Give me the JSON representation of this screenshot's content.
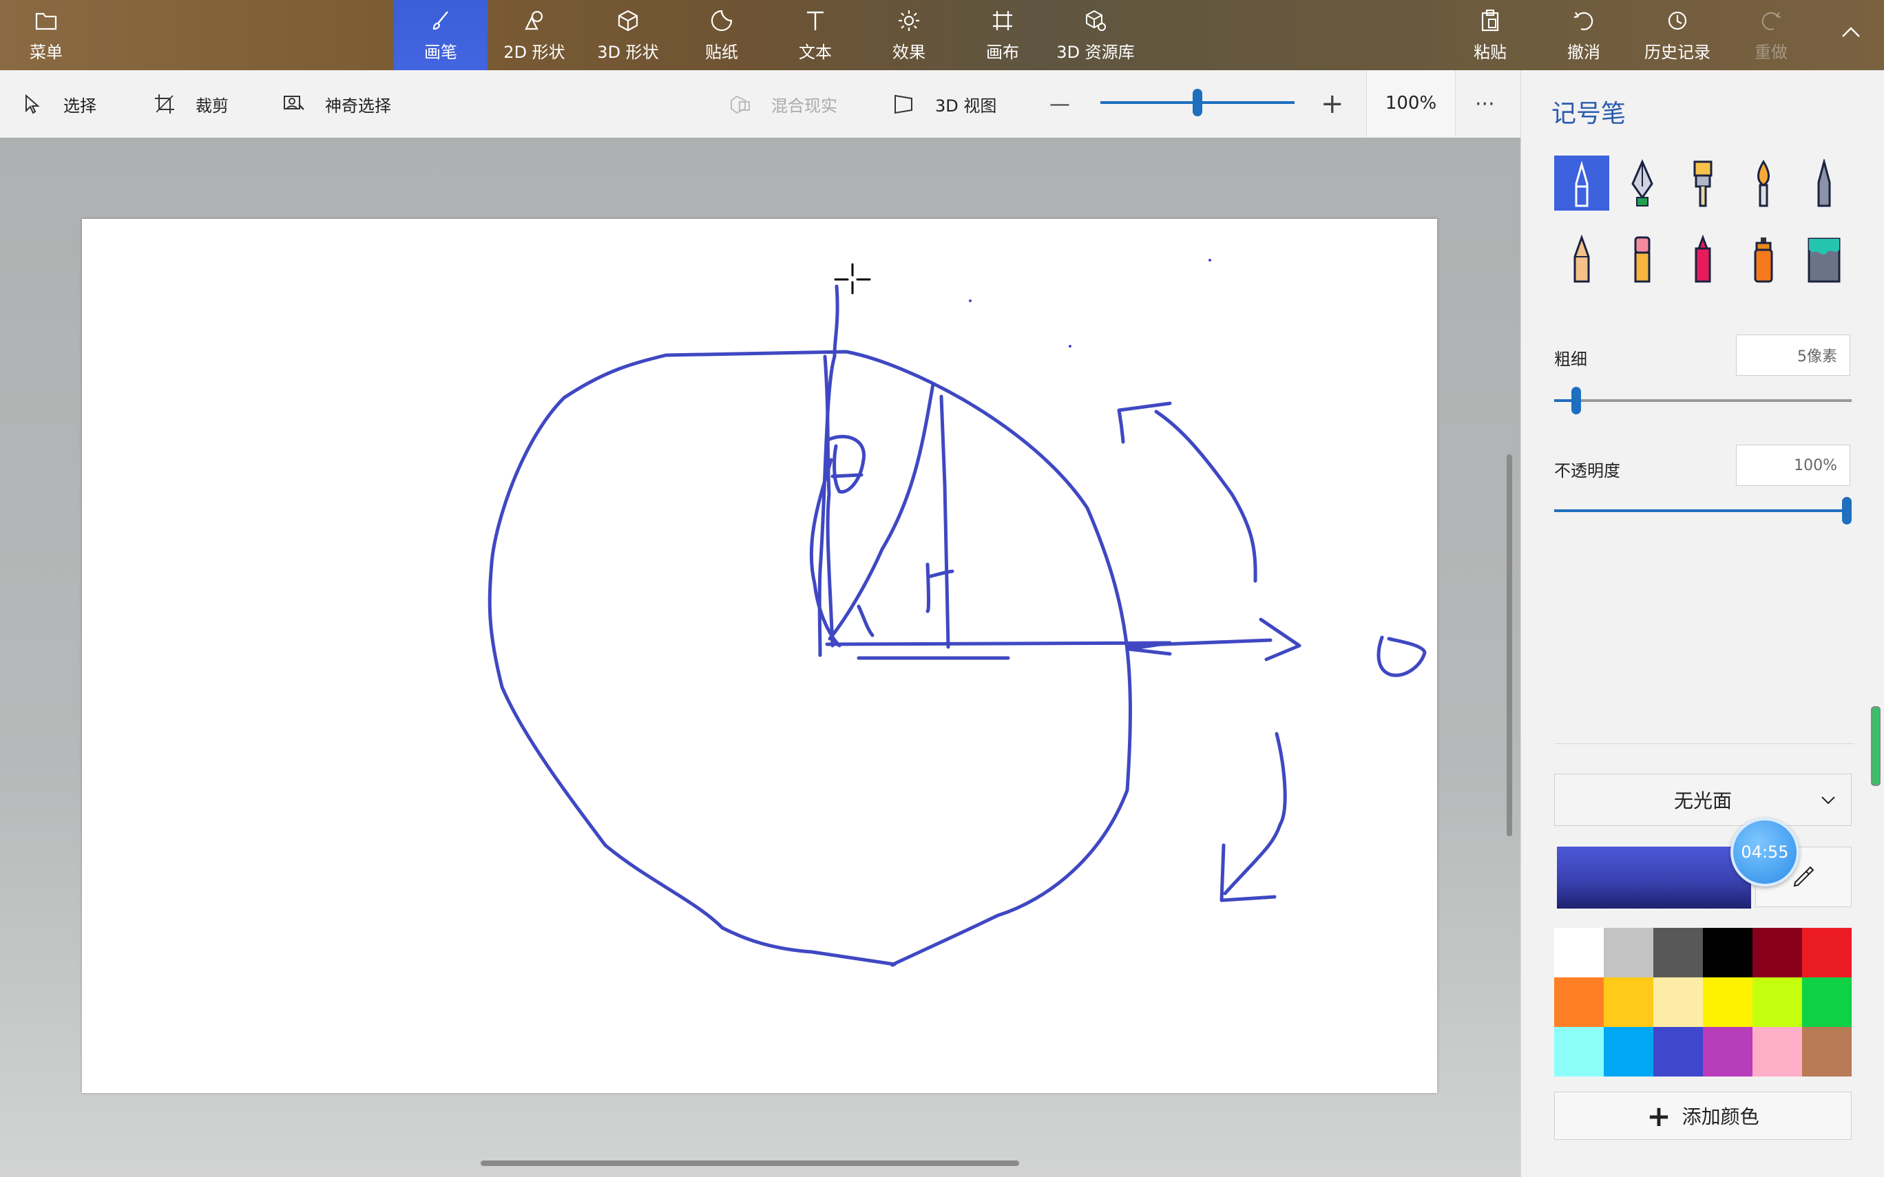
{
  "ribbon": {
    "menu_label": "菜单",
    "tabs": [
      {
        "label": "画笔",
        "icon": "brush-icon",
        "active": true
      },
      {
        "label": "2D 形状",
        "icon": "shapes-2d-icon"
      },
      {
        "label": "3D 形状",
        "icon": "cube-icon"
      },
      {
        "label": "贴纸",
        "icon": "sticker-icon"
      },
      {
        "label": "文本",
        "icon": "text-icon"
      },
      {
        "label": "效果",
        "icon": "sun-icon"
      },
      {
        "label": "画布",
        "icon": "canvas-icon"
      },
      {
        "label": "3D 资源库",
        "icon": "library-3d-icon"
      }
    ],
    "right_actions": [
      {
        "label": "粘贴",
        "icon": "paste-icon"
      },
      {
        "label": "撤消",
        "icon": "undo-icon"
      },
      {
        "label": "历史记录",
        "icon": "history-icon"
      },
      {
        "label": "重做",
        "icon": "redo-icon",
        "disabled": true
      }
    ],
    "collapse_icon": "chevron-up-icon"
  },
  "toolbar": {
    "select_label": "选择",
    "crop_label": "裁剪",
    "magic_select_label": "神奇选择",
    "mixed_reality_label": "混合现实",
    "view3d_label": "3D 视图",
    "zoom_minus": "—",
    "zoom_plus": "+",
    "zoom_value": "100%",
    "zoom_fraction": 0.5,
    "more": "···"
  },
  "panel": {
    "title": "记号笔",
    "brushes": [
      "marker-icon",
      "calligraphy-pen-icon",
      "oil-brush-icon",
      "watercolor-icon",
      "pixel-pen-icon",
      "pencil-icon",
      "eraser-icon",
      "crayon-icon",
      "spray-can-icon",
      "fill-bucket-icon"
    ],
    "selected_brush": 0,
    "thickness_label": "粗细",
    "thickness_value": "5像素",
    "thickness_fraction": 0.06,
    "opacity_label": "不透明度",
    "opacity_value": "100%",
    "opacity_fraction": 1.0,
    "finish_label": "无光面",
    "timer": "04:55",
    "current_color": "#3a42b0",
    "palette": [
      "#ffffff",
      "#c3c3c3",
      "#585858",
      "#000000",
      "#88001b",
      "#ec1c24",
      "#ff7f27",
      "#ffca18",
      "#fdeca6",
      "#fff200",
      "#c4ff0e",
      "#0ed145",
      "#8cfffb",
      "#00a8f3",
      "#3f48cc",
      "#b83dba",
      "#ffaec8",
      "#b97a56"
    ],
    "add_color_label": "添加颜色"
  },
  "drawing": {
    "stroke_color": "#3f48c2",
    "letter_r": "r",
    "letter_o": "o"
  }
}
